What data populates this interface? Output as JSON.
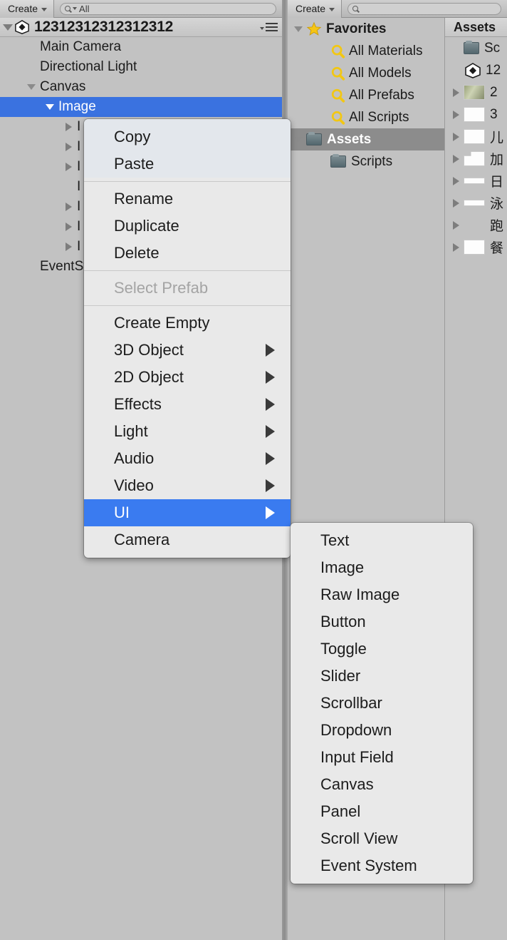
{
  "hierarchy": {
    "toolbar": {
      "create_label": "Create",
      "search_value": "All",
      "search_placeholder": ""
    },
    "scene_name": "12312312312312312",
    "rows": [
      {
        "label": "Main Camera",
        "indent": 1,
        "arrow": "none",
        "selected": false
      },
      {
        "label": "Directional Light",
        "indent": 1,
        "arrow": "none",
        "selected": false
      },
      {
        "label": "Canvas",
        "indent": 1,
        "arrow": "down",
        "selected": false
      },
      {
        "label": "Image",
        "indent": 2,
        "arrow": "down",
        "selected": true
      },
      {
        "label": "I",
        "indent": 3,
        "arrow": "right",
        "selected": false
      },
      {
        "label": "I",
        "indent": 3,
        "arrow": "right",
        "selected": false
      },
      {
        "label": "I",
        "indent": 3,
        "arrow": "right",
        "selected": false
      },
      {
        "label": "I",
        "indent": 3,
        "arrow": "none",
        "selected": false
      },
      {
        "label": "I",
        "indent": 3,
        "arrow": "right",
        "selected": false
      },
      {
        "label": "I",
        "indent": 3,
        "arrow": "right",
        "selected": false
      },
      {
        "label": "I",
        "indent": 3,
        "arrow": "right",
        "selected": false
      },
      {
        "label": "EventSystem",
        "indent": 1,
        "arrow": "none",
        "selected": false
      }
    ]
  },
  "project": {
    "toolbar": {
      "create_label": "Create",
      "search_value": "",
      "search_placeholder": ""
    },
    "tree": [
      {
        "label": "Favorites",
        "indent": 0,
        "icon": "star",
        "arrow": "down",
        "bold": true,
        "selected": false
      },
      {
        "label": "All Materials",
        "indent": 1,
        "icon": "magnifier",
        "arrow": "none",
        "bold": false,
        "selected": false
      },
      {
        "label": "All Models",
        "indent": 1,
        "icon": "magnifier",
        "arrow": "none",
        "bold": false,
        "selected": false
      },
      {
        "label": "All Prefabs",
        "indent": 1,
        "icon": "magnifier",
        "arrow": "none",
        "bold": false,
        "selected": false
      },
      {
        "label": "All Scripts",
        "indent": 1,
        "icon": "magnifier",
        "arrow": "none",
        "bold": false,
        "selected": false
      },
      {
        "label": "Assets",
        "indent": 0,
        "icon": "folder",
        "arrow": "down",
        "bold": true,
        "selected": true
      },
      {
        "label": "Scripts",
        "indent": 1,
        "icon": "folder",
        "arrow": "none",
        "bold": false,
        "selected": false
      }
    ],
    "assets_tab_label": "Assets",
    "assets": [
      {
        "label": "Sc",
        "icon": "folder",
        "arrow": "none"
      },
      {
        "label": "12",
        "icon": "unity-scene",
        "arrow": "none"
      },
      {
        "label": "2",
        "icon": "image-thumb",
        "arrow": "right"
      },
      {
        "label": "3",
        "icon": "white-thumb",
        "arrow": "right"
      },
      {
        "label": "儿",
        "icon": "white-thumb",
        "arrow": "right"
      },
      {
        "label": "加",
        "icon": "cut-thumb",
        "arrow": "right"
      },
      {
        "label": "日",
        "icon": "thin-thumb",
        "arrow": "right"
      },
      {
        "label": "泳",
        "icon": "thin-thumb",
        "arrow": "right"
      },
      {
        "label": "跑",
        "icon": "empty-thumb",
        "arrow": "right"
      },
      {
        "label": "餐",
        "icon": "white-thumb",
        "arrow": "right"
      }
    ]
  },
  "context_menu": {
    "groups": [
      {
        "highlighted_group": true,
        "items": [
          {
            "label": "Copy",
            "submenu": false,
            "disabled": false,
            "highlighted": false
          },
          {
            "label": "Paste",
            "submenu": false,
            "disabled": false,
            "highlighted": false
          }
        ]
      },
      {
        "highlighted_group": false,
        "items": [
          {
            "label": "Rename",
            "submenu": false,
            "disabled": false,
            "highlighted": false
          },
          {
            "label": "Duplicate",
            "submenu": false,
            "disabled": false,
            "highlighted": false
          },
          {
            "label": "Delete",
            "submenu": false,
            "disabled": false,
            "highlighted": false
          }
        ]
      },
      {
        "highlighted_group": false,
        "items": [
          {
            "label": "Select Prefab",
            "submenu": false,
            "disabled": true,
            "highlighted": false
          }
        ]
      },
      {
        "highlighted_group": false,
        "items": [
          {
            "label": "Create Empty",
            "submenu": false,
            "disabled": false,
            "highlighted": false
          },
          {
            "label": "3D Object",
            "submenu": true,
            "disabled": false,
            "highlighted": false
          },
          {
            "label": "2D Object",
            "submenu": true,
            "disabled": false,
            "highlighted": false
          },
          {
            "label": "Effects",
            "submenu": true,
            "disabled": false,
            "highlighted": false
          },
          {
            "label": "Light",
            "submenu": true,
            "disabled": false,
            "highlighted": false
          },
          {
            "label": "Audio",
            "submenu": true,
            "disabled": false,
            "highlighted": false
          },
          {
            "label": "Video",
            "submenu": true,
            "disabled": false,
            "highlighted": false
          },
          {
            "label": "UI",
            "submenu": true,
            "disabled": false,
            "highlighted": true
          },
          {
            "label": "Camera",
            "submenu": false,
            "disabled": false,
            "highlighted": false
          }
        ]
      }
    ]
  },
  "ui_submenu": {
    "items": [
      {
        "label": "Text"
      },
      {
        "label": "Image"
      },
      {
        "label": "Raw Image"
      },
      {
        "label": "Button"
      },
      {
        "label": "Toggle"
      },
      {
        "label": "Slider"
      },
      {
        "label": "Scrollbar"
      },
      {
        "label": "Dropdown"
      },
      {
        "label": "Input Field"
      },
      {
        "label": "Canvas"
      },
      {
        "label": "Panel"
      },
      {
        "label": "Scroll View"
      },
      {
        "label": "Event System"
      }
    ]
  },
  "colors": {
    "selection_blue": "#3a72e0",
    "menu_highlight_blue": "#3a7bf0",
    "panel_gray": "#c2c2c2",
    "menu_bg": "#e9e9e9",
    "project_row_selected": "#8c8c8c"
  }
}
